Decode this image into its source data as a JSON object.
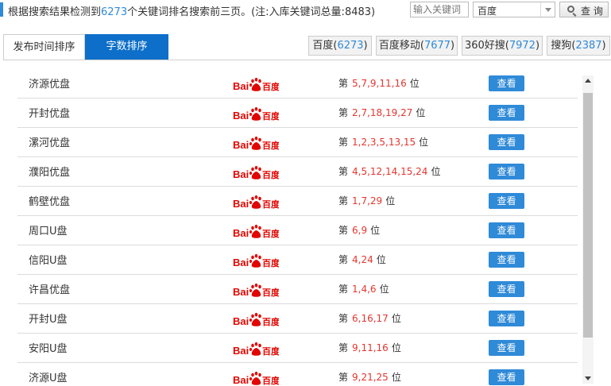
{
  "summary": {
    "prefix": "根据搜索结果检测到",
    "count": "6273",
    "suffix": "个关键词排名搜索前三页。(注:入库关键词总量:8483)"
  },
  "search": {
    "placeholder": "输入关键词",
    "engine_selected": "百度",
    "query_label": "查 询"
  },
  "tabs": [
    {
      "label": "发布时间排序",
      "active": false
    },
    {
      "label": "字数排序",
      "active": true
    }
  ],
  "engines": [
    {
      "name": "百度",
      "count": "6273"
    },
    {
      "name": "百度移动",
      "count": "7677"
    },
    {
      "name": "360好搜",
      "count": "7972"
    },
    {
      "name": "搜狗",
      "count": "2387"
    }
  ],
  "rank_prefix": "第",
  "rank_suffix": "位",
  "view_label": "查看",
  "logo": {
    "bai": "Bai",
    "du": "百度",
    "paw_color": "#e10601",
    "text_color": "#e10601"
  },
  "rows": [
    {
      "keyword": "济源优盘",
      "positions": "5,7,9,11,16"
    },
    {
      "keyword": "开封优盘",
      "positions": "2,7,18,19,27"
    },
    {
      "keyword": "漯河优盘",
      "positions": "1,2,3,5,13,15"
    },
    {
      "keyword": "濮阳优盘",
      "positions": "4,5,12,14,15,24"
    },
    {
      "keyword": "鹤壁优盘",
      "positions": "1,7,29"
    },
    {
      "keyword": "周口U盘",
      "positions": "6,9"
    },
    {
      "keyword": "信阳U盘",
      "positions": "4,24"
    },
    {
      "keyword": "许昌优盘",
      "positions": "1,4,6"
    },
    {
      "keyword": "开封U盘",
      "positions": "6,16,17"
    },
    {
      "keyword": "安阳U盘",
      "positions": "9,11,16"
    },
    {
      "keyword": "济源U盘",
      "positions": "9,21,25"
    }
  ],
  "colors": {
    "accent": "#2f8ad8",
    "active_tab": "#0d6fc9",
    "rank": "#e3362f"
  }
}
